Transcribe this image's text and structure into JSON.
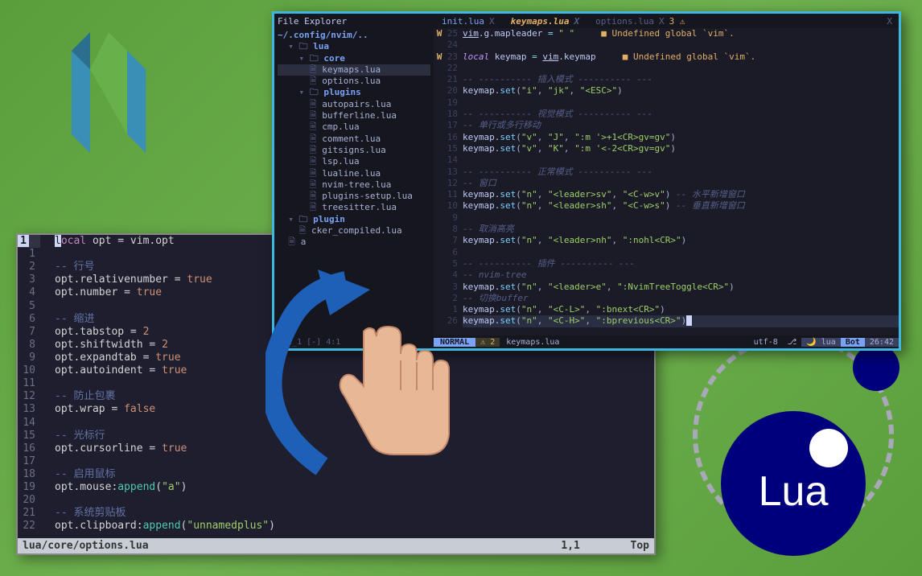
{
  "lua_logo_text": "Lua",
  "top_editor": {
    "tabs": [
      {
        "label": "init.lua",
        "close": "X"
      },
      {
        "label": "keymaps.lua",
        "close": "X",
        "active": true
      },
      {
        "label": "options.lua",
        "close": "X",
        "warn": "3"
      }
    ],
    "close_all": "X",
    "tree": {
      "title": "File Explorer",
      "path": "~/.config/nvim/..",
      "nodes": [
        {
          "indent": 1,
          "type": "folder",
          "icon": "▾ 🗀",
          "label": "lua"
        },
        {
          "indent": 2,
          "type": "folder",
          "icon": "▾ 🗀",
          "label": "core"
        },
        {
          "indent": 3,
          "type": "file",
          "icon": "🗎",
          "label": "keymaps.lua",
          "active": true
        },
        {
          "indent": 3,
          "type": "file",
          "icon": "🗎",
          "label": "options.lua"
        },
        {
          "indent": 2,
          "type": "folder",
          "icon": "▾ 🗀",
          "label": "plugins"
        },
        {
          "indent": 3,
          "type": "file",
          "icon": "🗎",
          "label": "autopairs.lua"
        },
        {
          "indent": 3,
          "type": "file",
          "icon": "🗎",
          "label": "bufferline.lua"
        },
        {
          "indent": 3,
          "type": "file",
          "icon": "🗎",
          "label": "cmp.lua"
        },
        {
          "indent": 3,
          "type": "file",
          "icon": "🗎",
          "label": "comment.lua"
        },
        {
          "indent": 3,
          "type": "file",
          "icon": "🗎",
          "label": "gitsigns.lua"
        },
        {
          "indent": 3,
          "type": "file",
          "icon": "🗎",
          "label": "lsp.lua"
        },
        {
          "indent": 3,
          "type": "file",
          "icon": "🗎",
          "label": "lualine.lua"
        },
        {
          "indent": 3,
          "type": "file",
          "icon": "🗎",
          "label": "nvim-tree.lua"
        },
        {
          "indent": 3,
          "type": "file",
          "icon": "🗎",
          "label": "plugins-setup.lua"
        },
        {
          "indent": 3,
          "type": "file",
          "icon": "🗎",
          "label": "treesitter.lua"
        },
        {
          "indent": 1,
          "type": "folder",
          "icon": "▾ 🗀",
          "label": "plugin"
        },
        {
          "indent": 2,
          "type": "file",
          "icon": "🗎",
          "label": "cker_compiled.lua"
        },
        {
          "indent": 1,
          "type": "file",
          "icon": "🗎",
          "label": "a"
        }
      ],
      "footer": "ree_1 [-]        4:1"
    },
    "code": [
      {
        "warn": "W",
        "n": "25",
        "segs": [
          {
            "t": "vim",
            "c": "id uline"
          },
          {
            "t": ".g.mapleader ",
            "c": "id"
          },
          {
            "t": "=",
            "c": "op"
          },
          {
            "t": " ",
            "c": ""
          },
          {
            "t": "\" \"",
            "c": "str"
          },
          {
            "t": "     ",
            "c": ""
          },
          {
            "t": "■ Undefined global `vim`.",
            "c": "diag"
          }
        ]
      },
      {
        "n": "24",
        "segs": []
      },
      {
        "warn": "W",
        "n": "23",
        "segs": [
          {
            "t": "local",
            "c": "kw"
          },
          {
            "t": " keymap ",
            "c": "id"
          },
          {
            "t": "=",
            "c": "op"
          },
          {
            "t": " ",
            "c": ""
          },
          {
            "t": "vim",
            "c": "id uline"
          },
          {
            "t": ".keymap",
            "c": "id"
          },
          {
            "t": "     ",
            "c": ""
          },
          {
            "t": "■ Undefined global `vim`.",
            "c": "diag"
          }
        ]
      },
      {
        "n": "22",
        "segs": []
      },
      {
        "n": "21",
        "segs": [
          {
            "t": "-- ---------- 插入模式 ---------- ---",
            "c": "cmt"
          }
        ]
      },
      {
        "n": "20",
        "segs": [
          {
            "t": "keymap.",
            "c": "id"
          },
          {
            "t": "set",
            "c": "call"
          },
          {
            "t": "(",
            "c": "punc"
          },
          {
            "t": "\"i\"",
            "c": "str"
          },
          {
            "t": ", ",
            "c": "punc"
          },
          {
            "t": "\"jk\"",
            "c": "str"
          },
          {
            "t": ", ",
            "c": "punc"
          },
          {
            "t": "\"<ESC>\"",
            "c": "str"
          },
          {
            "t": ")",
            "c": "punc"
          }
        ]
      },
      {
        "n": "19",
        "segs": []
      },
      {
        "n": "18",
        "segs": [
          {
            "t": "-- ---------- 视觉模式 ---------- ---",
            "c": "cmt"
          }
        ]
      },
      {
        "n": "17",
        "segs": [
          {
            "t": "-- 单行或多行移动",
            "c": "cmt"
          }
        ]
      },
      {
        "n": "16",
        "segs": [
          {
            "t": "keymap.",
            "c": "id"
          },
          {
            "t": "set",
            "c": "call"
          },
          {
            "t": "(",
            "c": "punc"
          },
          {
            "t": "\"v\"",
            "c": "str"
          },
          {
            "t": ", ",
            "c": "punc"
          },
          {
            "t": "\"J\"",
            "c": "str"
          },
          {
            "t": ", ",
            "c": "punc"
          },
          {
            "t": "\":m '>+1<CR>gv=gv\"",
            "c": "str"
          },
          {
            "t": ")",
            "c": "punc"
          }
        ]
      },
      {
        "n": "15",
        "segs": [
          {
            "t": "keymap.",
            "c": "id"
          },
          {
            "t": "set",
            "c": "call"
          },
          {
            "t": "(",
            "c": "punc"
          },
          {
            "t": "\"v\"",
            "c": "str"
          },
          {
            "t": ", ",
            "c": "punc"
          },
          {
            "t": "\"K\"",
            "c": "str"
          },
          {
            "t": ", ",
            "c": "punc"
          },
          {
            "t": "\":m '<-2<CR>gv=gv\"",
            "c": "str"
          },
          {
            "t": ")",
            "c": "punc"
          }
        ]
      },
      {
        "n": "14",
        "segs": []
      },
      {
        "n": "13",
        "segs": [
          {
            "t": "-- ---------- 正常模式 ---------- ---",
            "c": "cmt"
          }
        ]
      },
      {
        "n": "12",
        "segs": [
          {
            "t": "-- 窗口",
            "c": "cmt"
          }
        ]
      },
      {
        "n": "11",
        "segs": [
          {
            "t": "keymap.",
            "c": "id"
          },
          {
            "t": "set",
            "c": "call"
          },
          {
            "t": "(",
            "c": "punc"
          },
          {
            "t": "\"n\"",
            "c": "str"
          },
          {
            "t": ", ",
            "c": "punc"
          },
          {
            "t": "\"<leader>sv\"",
            "c": "str"
          },
          {
            "t": ", ",
            "c": "punc"
          },
          {
            "t": "\"<C-w>v\"",
            "c": "str"
          },
          {
            "t": ") ",
            "c": "punc"
          },
          {
            "t": "-- 水平新增窗口",
            "c": "cmt"
          }
        ]
      },
      {
        "n": "10",
        "segs": [
          {
            "t": "keymap.",
            "c": "id"
          },
          {
            "t": "set",
            "c": "call"
          },
          {
            "t": "(",
            "c": "punc"
          },
          {
            "t": "\"n\"",
            "c": "str"
          },
          {
            "t": ", ",
            "c": "punc"
          },
          {
            "t": "\"<leader>sh\"",
            "c": "str"
          },
          {
            "t": ", ",
            "c": "punc"
          },
          {
            "t": "\"<C-w>s\"",
            "c": "str"
          },
          {
            "t": ") ",
            "c": "punc"
          },
          {
            "t": "-- 垂直新增窗口",
            "c": "cmt"
          }
        ]
      },
      {
        "n": "9",
        "segs": []
      },
      {
        "n": "8",
        "segs": [
          {
            "t": "-- 取消高亮",
            "c": "cmt"
          }
        ]
      },
      {
        "n": "7",
        "segs": [
          {
            "t": "keymap.",
            "c": "id"
          },
          {
            "t": "set",
            "c": "call"
          },
          {
            "t": "(",
            "c": "punc"
          },
          {
            "t": "\"n\"",
            "c": "str"
          },
          {
            "t": ", ",
            "c": "punc"
          },
          {
            "t": "\"<leader>nh\"",
            "c": "str"
          },
          {
            "t": ", ",
            "c": "punc"
          },
          {
            "t": "\":nohl<CR>\"",
            "c": "str"
          },
          {
            "t": ")",
            "c": "punc"
          }
        ]
      },
      {
        "n": "6",
        "segs": []
      },
      {
        "n": "5",
        "segs": [
          {
            "t": "-- ---------- 插件 ---------- ---",
            "c": "cmt"
          }
        ]
      },
      {
        "n": "4",
        "segs": [
          {
            "t": "-- nvim-tree",
            "c": "cmt"
          }
        ]
      },
      {
        "n": "3",
        "segs": [
          {
            "t": "keymap.",
            "c": "id"
          },
          {
            "t": "set",
            "c": "call"
          },
          {
            "t": "(",
            "c": "punc"
          },
          {
            "t": "\"n\"",
            "c": "str"
          },
          {
            "t": ", ",
            "c": "punc"
          },
          {
            "t": "\"<leader>e\"",
            "c": "str"
          },
          {
            "t": ", ",
            "c": "punc"
          },
          {
            "t": "\":NvimTreeToggle<CR>\"",
            "c": "str"
          },
          {
            "t": ")",
            "c": "punc"
          }
        ]
      },
      {
        "n": "2",
        "segs": [
          {
            "t": "-- 切换buffer",
            "c": "cmt"
          }
        ]
      },
      {
        "n": "1",
        "segs": [
          {
            "t": "keymap.",
            "c": "id"
          },
          {
            "t": "set",
            "c": "call"
          },
          {
            "t": "(",
            "c": "punc"
          },
          {
            "t": "\"n\"",
            "c": "str"
          },
          {
            "t": ", ",
            "c": "punc"
          },
          {
            "t": "\"<C-L>\"",
            "c": "str"
          },
          {
            "t": ", ",
            "c": "punc"
          },
          {
            "t": "\":bnext<CR>\"",
            "c": "str"
          },
          {
            "t": ")",
            "c": "punc"
          }
        ]
      },
      {
        "n": "26",
        "cursor": true,
        "segs": [
          {
            "t": "keymap.",
            "c": "id"
          },
          {
            "t": "set",
            "c": "call"
          },
          {
            "t": "(",
            "c": "punc"
          },
          {
            "t": "\"n\"",
            "c": "str"
          },
          {
            "t": ", ",
            "c": "punc"
          },
          {
            "t": "\"<C-H>\"",
            "c": "str"
          },
          {
            "t": ", ",
            "c": "punc"
          },
          {
            "t": "\":bprevious<CR>\"",
            "c": "str"
          },
          {
            "t": ")",
            "c": "punc"
          }
        ]
      }
    ],
    "status": {
      "mode": "NORMAL",
      "warn_icon": "⚠",
      "warn_count": "2",
      "file": "keymaps.lua",
      "encoding": "utf-8",
      "branch": "⎇",
      "lang": "🌙 lua",
      "pos": "Bot",
      "time": "26:42"
    }
  },
  "bottom_editor": {
    "lines": [
      {
        "n": "1",
        "abs": true,
        "segs": [
          {
            "t": "l",
            "c": "cursor-block"
          },
          {
            "t": "ocal",
            "c": "bot-kw"
          },
          {
            "t": " opt = vim.opt",
            "c": "bot-var"
          }
        ]
      },
      {
        "n": "1",
        "segs": []
      },
      {
        "n": "2",
        "segs": [
          {
            "t": "-- 行号",
            "c": "bot-cmt"
          }
        ]
      },
      {
        "n": "3",
        "segs": [
          {
            "t": "opt.relativenumber = ",
            "c": "bot-var"
          },
          {
            "t": "true",
            "c": "bot-bool"
          }
        ]
      },
      {
        "n": "4",
        "segs": [
          {
            "t": "opt.number = ",
            "c": "bot-var"
          },
          {
            "t": "true",
            "c": "bot-bool"
          }
        ]
      },
      {
        "n": "5",
        "segs": []
      },
      {
        "n": "6",
        "segs": [
          {
            "t": "-- 缩进",
            "c": "bot-cmt"
          }
        ]
      },
      {
        "n": "7",
        "segs": [
          {
            "t": "opt.tabstop = ",
            "c": "bot-var"
          },
          {
            "t": "2",
            "c": "bot-num"
          }
        ]
      },
      {
        "n": "8",
        "segs": [
          {
            "t": "opt.shiftwidth = ",
            "c": "bot-var"
          },
          {
            "t": "2",
            "c": "bot-num"
          }
        ]
      },
      {
        "n": "9",
        "segs": [
          {
            "t": "opt.expandtab = ",
            "c": "bot-var"
          },
          {
            "t": "true",
            "c": "bot-bool"
          }
        ]
      },
      {
        "n": "10",
        "segs": [
          {
            "t": "opt.autoindent = ",
            "c": "bot-var"
          },
          {
            "t": "true",
            "c": "bot-bool"
          }
        ]
      },
      {
        "n": "11",
        "segs": []
      },
      {
        "n": "12",
        "segs": [
          {
            "t": "-- 防止包裹",
            "c": "bot-cmt"
          }
        ]
      },
      {
        "n": "13",
        "segs": [
          {
            "t": "opt.wrap = ",
            "c": "bot-var"
          },
          {
            "t": "false",
            "c": "bot-bool"
          }
        ]
      },
      {
        "n": "14",
        "segs": []
      },
      {
        "n": "15",
        "segs": [
          {
            "t": "-- 光标行",
            "c": "bot-cmt"
          }
        ]
      },
      {
        "n": "16",
        "segs": [
          {
            "t": "opt.cursorline = ",
            "c": "bot-var"
          },
          {
            "t": "true",
            "c": "bot-bool"
          }
        ]
      },
      {
        "n": "17",
        "segs": []
      },
      {
        "n": "18",
        "segs": [
          {
            "t": "-- 启用鼠标",
            "c": "bot-cmt"
          }
        ]
      },
      {
        "n": "19",
        "segs": [
          {
            "t": "opt.mouse:",
            "c": "bot-var"
          },
          {
            "t": "append",
            "c": "bot-fn"
          },
          {
            "t": "(",
            "c": "bot-var"
          },
          {
            "t": "\"a\"",
            "c": "bot-str"
          },
          {
            "t": ")",
            "c": "bot-var"
          }
        ]
      },
      {
        "n": "20",
        "segs": []
      },
      {
        "n": "21",
        "segs": [
          {
            "t": "-- 系统剪贴板",
            "c": "bot-cmt"
          }
        ]
      },
      {
        "n": "22",
        "segs": [
          {
            "t": "opt.clipboard:",
            "c": "bot-var"
          },
          {
            "t": "append",
            "c": "bot-fn"
          },
          {
            "t": "(",
            "c": "bot-var"
          },
          {
            "t": "\"unnamedplus\"",
            "c": "bot-str"
          },
          {
            "t": ")",
            "c": "bot-var"
          }
        ]
      }
    ],
    "status": {
      "file": "lua/core/options.lua",
      "pos": "1,1",
      "scroll": "Top"
    }
  }
}
